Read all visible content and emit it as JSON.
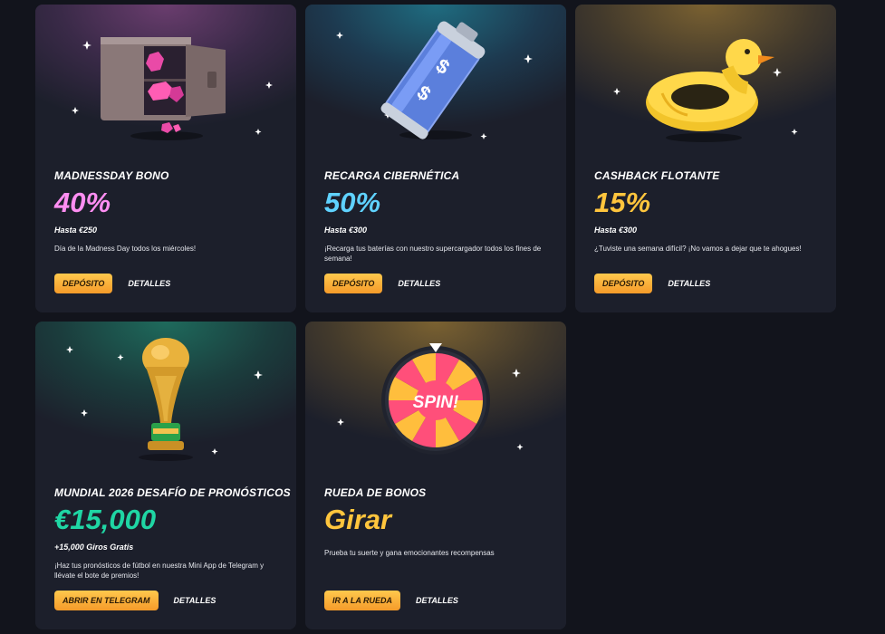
{
  "colors": {
    "pink": "#ff8ef2",
    "cyan": "#5fd2ff",
    "gold": "#ffc53d",
    "green": "#1fd6a4",
    "button_top": "#ffc84d",
    "button_bottom": "#f59b2a"
  },
  "cards": [
    {
      "image": "safe-with-gems",
      "title": "MADNESSDAY BONO",
      "value": "40%",
      "value_color": "#ff8ef2",
      "limit": "Hasta €250",
      "description": "Día de la Madness Day todos los miércoles!",
      "button": "DEPÓSITO",
      "details": "DETALLES"
    },
    {
      "image": "cyber-battery",
      "title": "RECARGA CIBERNÉTICA",
      "value": "50%",
      "value_color": "#5fd2ff",
      "limit": "Hasta €300",
      "description": "¡Recarga tus baterías con nuestro supercargador todos los fines de semana!",
      "button": "DEPÓSITO",
      "details": "DETALLES"
    },
    {
      "image": "rubber-duck-float",
      "title": "CASHBACK FLOTANTE",
      "value": "15%",
      "value_color": "#ffc53d",
      "limit": "Hasta €300",
      "description": "¿Tuviste una semana difícil? ¡No vamos a dejar que te ahogues!",
      "button": "DEPÓSITO",
      "details": "DETALLES"
    },
    {
      "image": "world-cup-trophy",
      "title": "MUNDIAL 2026 DESAFÍO DE PRONÓSTICOS",
      "value": "€15,000",
      "value_color": "#1fd6a4",
      "limit": "+15,000 Giros Gratis",
      "description": "¡Haz tus pronósticos de fútbol en nuestra Mini App de Telegram y llévate el bote de premios!",
      "button": "ABRIR EN TELEGRAM",
      "details": "DETALLES"
    },
    {
      "image": "bonus-wheel",
      "title": "RUEDA DE BONOS",
      "value": "Girar",
      "value_color": "#ffc53d",
      "description": "Prueba tu suerte y gana emocionantes recompensas",
      "button": "IR A LA RUEDA",
      "details": "DETALLES",
      "wheel_label": "SPIN!"
    }
  ]
}
